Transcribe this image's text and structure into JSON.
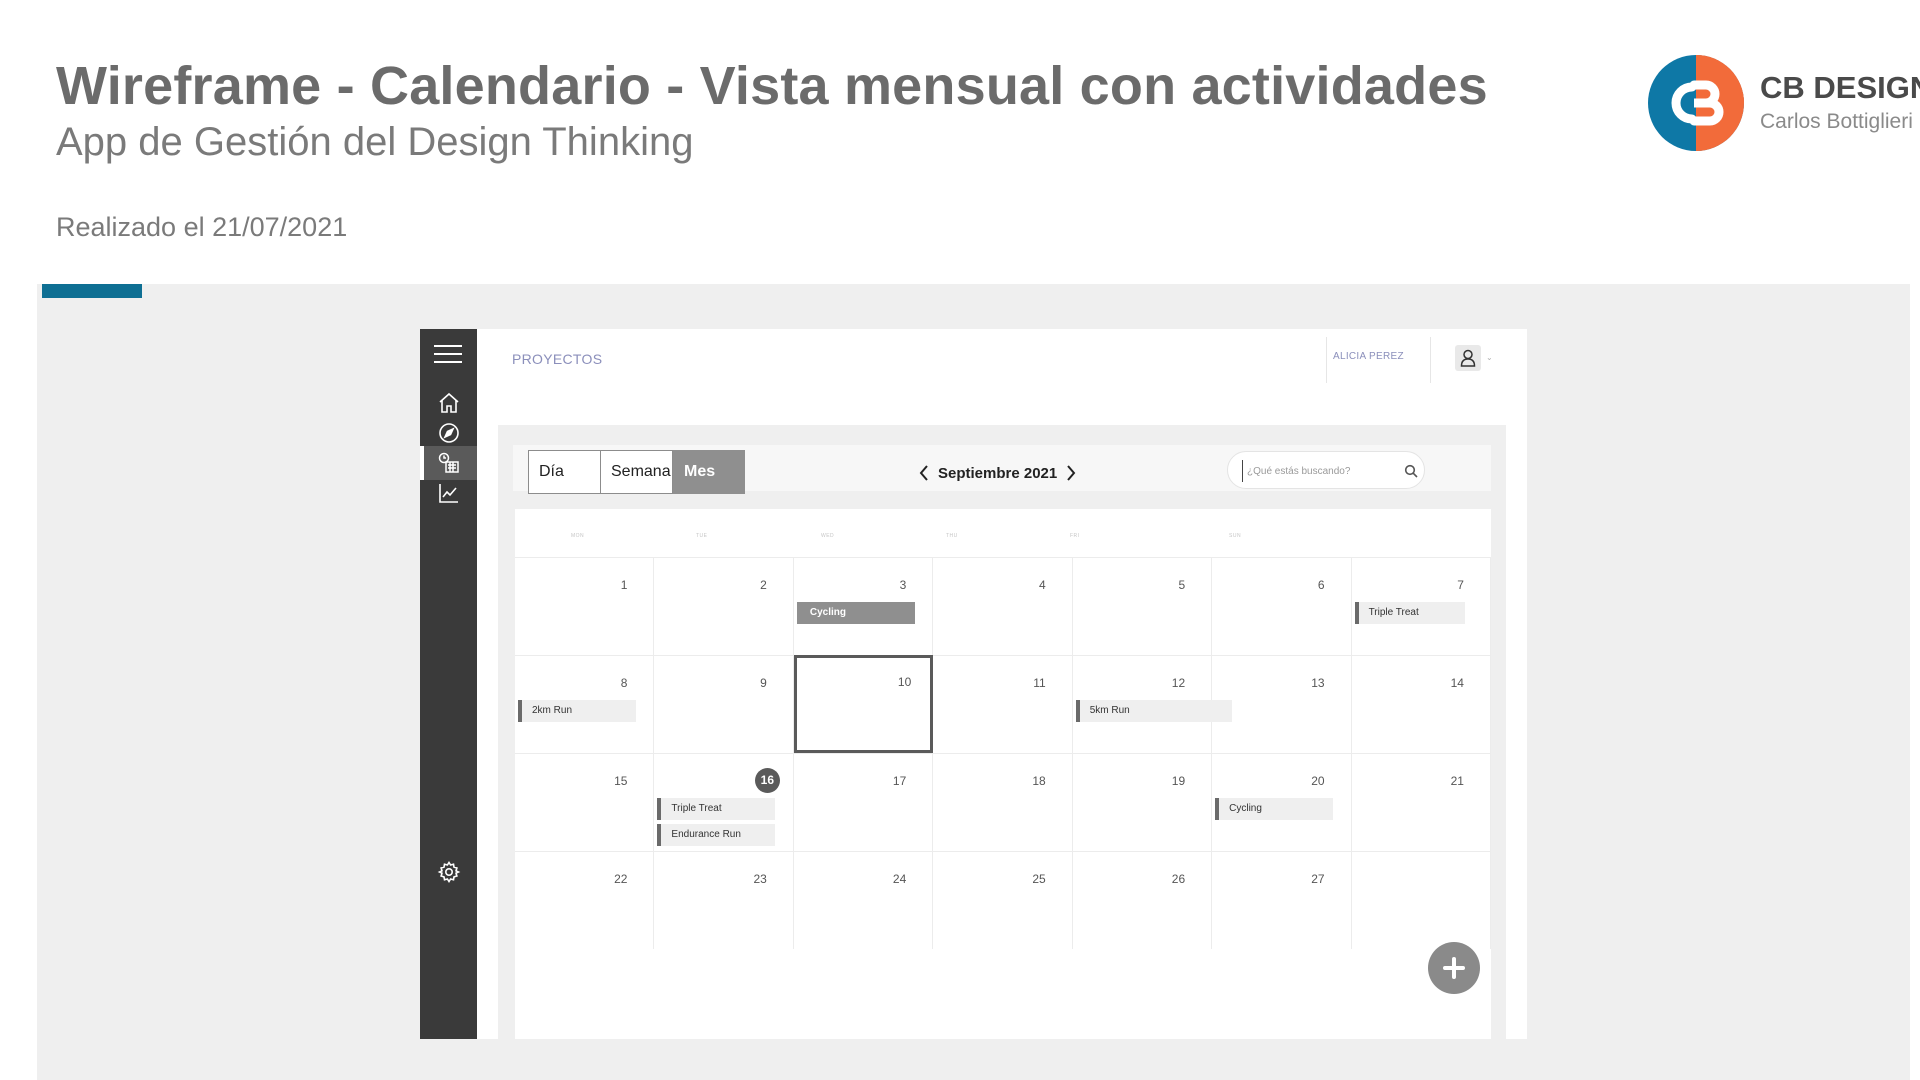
{
  "header": {
    "title": "Wireframe - Calendario - Vista mensual con actividades",
    "subtitle": "App de Gestión del Design Thinking",
    "date": "Realizado el 21/07/2021"
  },
  "brand": {
    "name": "CB DESIGN",
    "author": "Carlos Bottiglieri",
    "logo_icon": "cb-logo-icon",
    "colors": {
      "orange": "#f26b3a",
      "blue": "#0e78a6"
    }
  },
  "colors": {
    "accent": "#0e6f93",
    "sidebar": "#3a3a3a",
    "link": "#8b8fbb"
  },
  "app": {
    "breadcrumb": "PROYECTOS",
    "user_name": "ALICIA PEREZ",
    "sidebar": {
      "items": [
        {
          "id": "home",
          "icon": "home-icon"
        },
        {
          "id": "explore",
          "icon": "compass-icon"
        },
        {
          "id": "calendar",
          "icon": "calendar-icon",
          "active": true
        },
        {
          "id": "stats",
          "icon": "chart-line-icon"
        }
      ],
      "settings_icon": "gear-icon"
    },
    "toolbar": {
      "views": [
        "Día",
        "Semana",
        "Mes"
      ],
      "active_view": "Mes",
      "month_label": "Septiembre 2021",
      "search_placeholder": "¿Qué estás buscando?"
    },
    "weekdays": [
      "MON",
      "TUE",
      "WED",
      "THU",
      "FRI",
      "SUN"
    ],
    "weeks": [
      {
        "days": [
          "1",
          "2",
          "3",
          "4",
          "5",
          "6",
          "7"
        ]
      },
      {
        "days": [
          "8",
          "9",
          "10",
          "11",
          "12",
          "13",
          "14"
        ]
      },
      {
        "days": [
          "15",
          "16",
          "17",
          "18",
          "19",
          "20",
          "21"
        ]
      },
      {
        "days": [
          "22",
          "23",
          "24",
          "25",
          "26",
          "27",
          ""
        ]
      }
    ],
    "selected_day": "10",
    "current_day": "16",
    "events": [
      {
        "label": "Cycling",
        "day": "3",
        "style": "filled"
      },
      {
        "label": "Triple Treat",
        "day": "7",
        "style": "outline"
      },
      {
        "label": "2km Run",
        "day": "8",
        "style": "outline"
      },
      {
        "label": "5km Run",
        "day": "12",
        "style": "outline"
      },
      {
        "label": "Triple Treat",
        "day": "16",
        "style": "outline"
      },
      {
        "label": "Endurance Run",
        "day": "16",
        "style": "outline"
      },
      {
        "label": "Cycling",
        "day": "20",
        "style": "outline"
      }
    ],
    "add_button_icon": "plus-icon"
  }
}
